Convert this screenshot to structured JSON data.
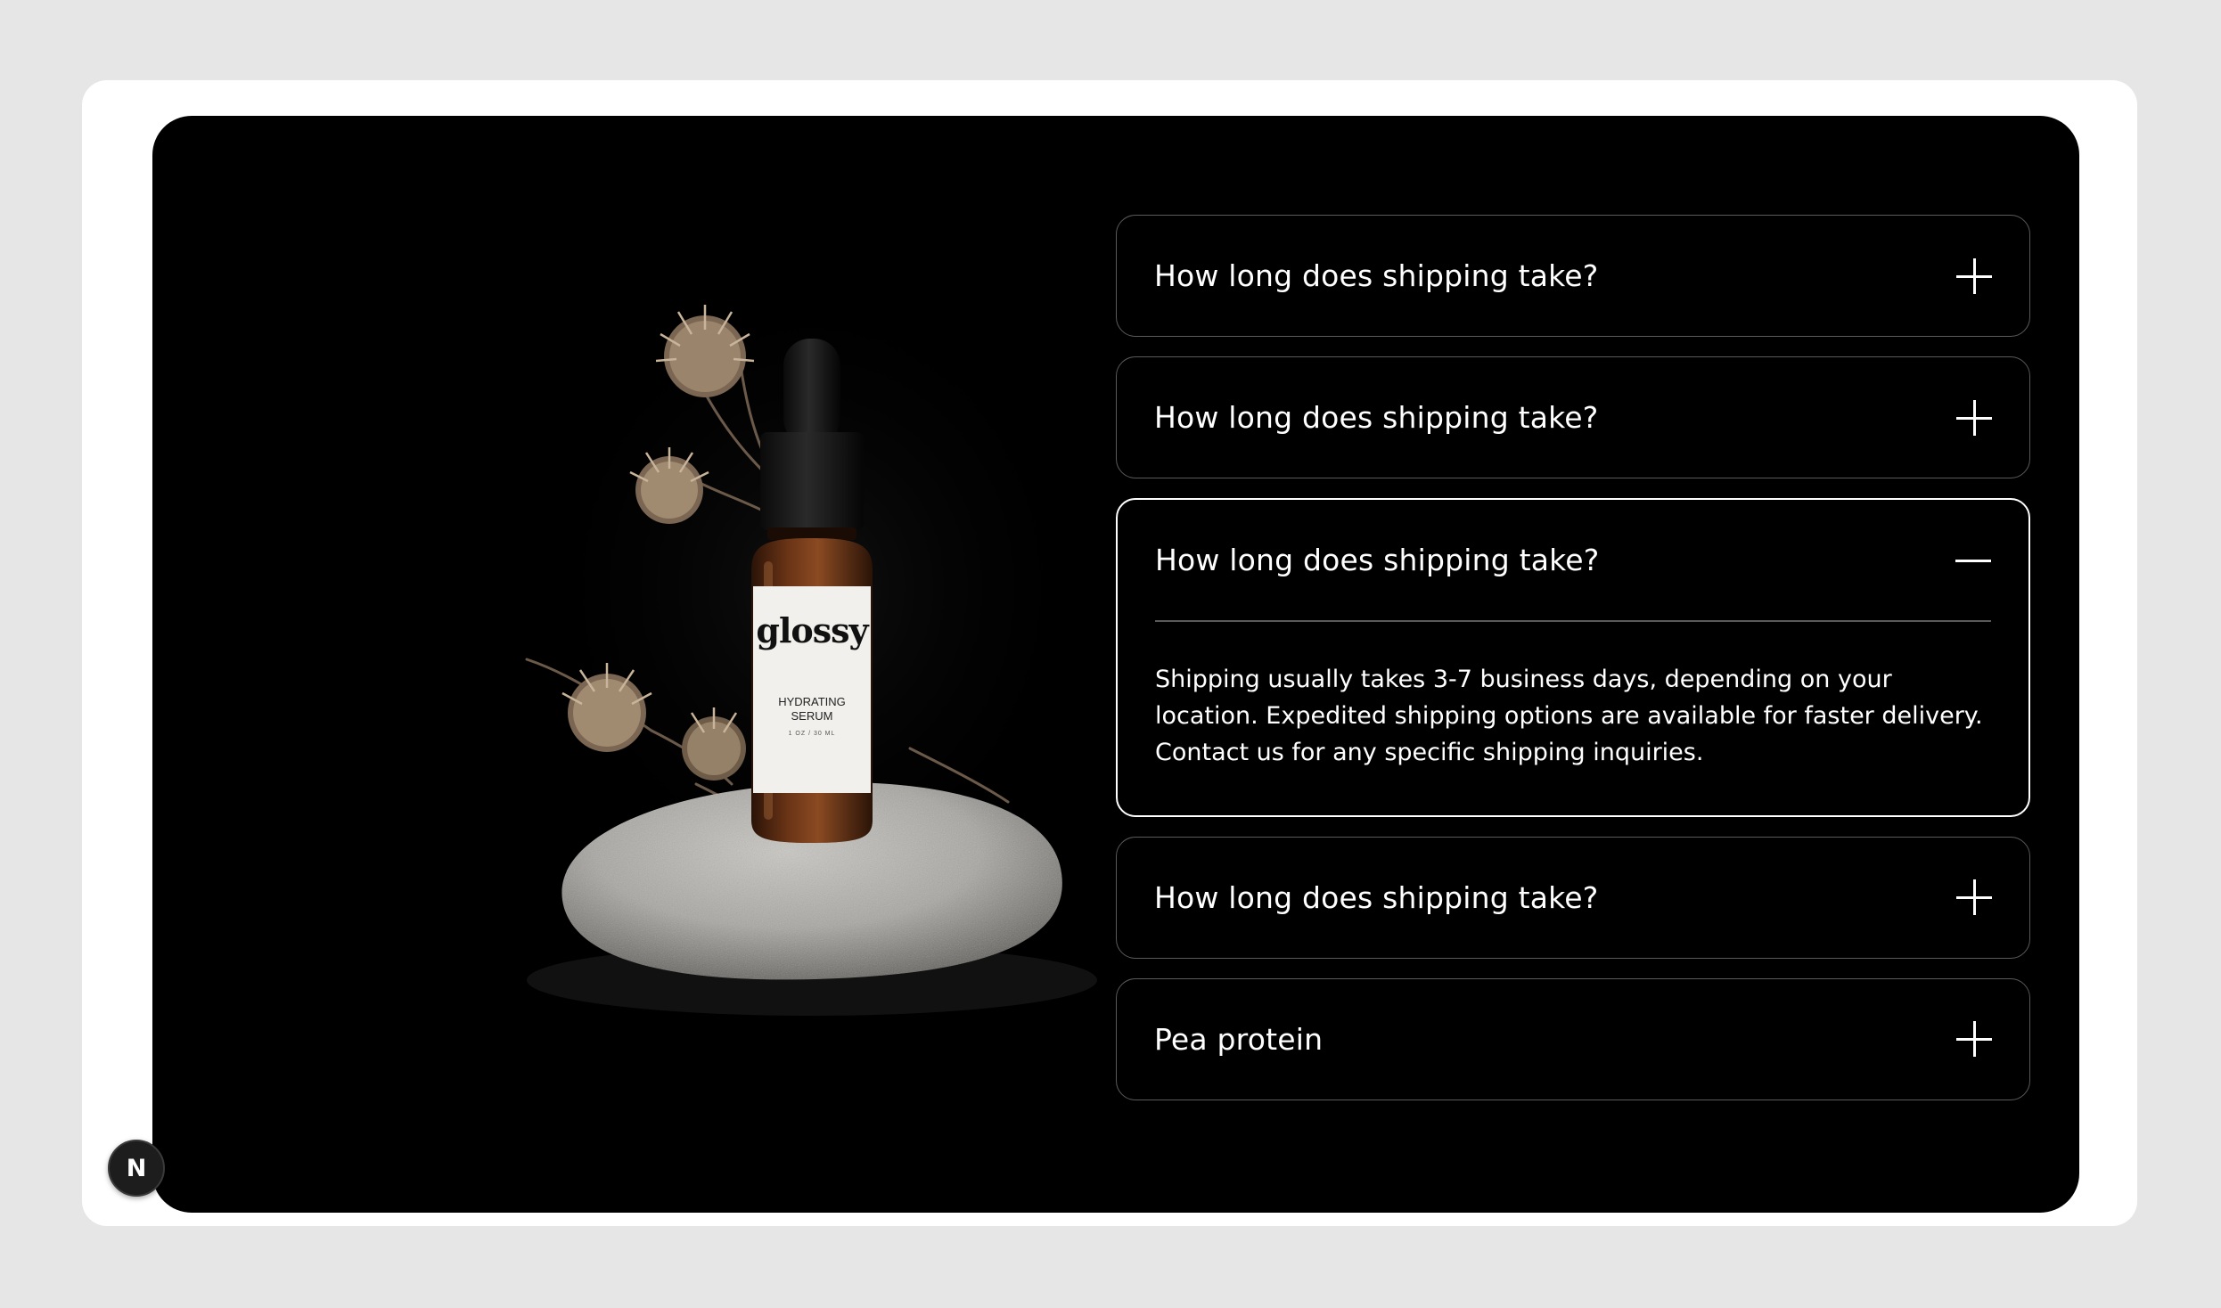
{
  "product": {
    "brand": "glossy",
    "name": "HYDRATING\nSERUM",
    "volume": "1 OZ / 30 ML"
  },
  "faq": {
    "items": [
      {
        "question": "How long does shipping take?",
        "open": false
      },
      {
        "question": "How long does shipping take?",
        "open": false
      },
      {
        "question": "How long does shipping take?",
        "open": true,
        "answer": "Shipping usually takes 3-7 business days, depending on your location. Expedited shipping options are available for faster delivery. Contact us for any specific shipping inquiries."
      },
      {
        "question": "How long does shipping take?",
        "open": false
      },
      {
        "question": "Pea protein",
        "open": false
      }
    ]
  },
  "badge": {
    "label": "N"
  },
  "colors": {
    "page_background": "#e6e6e6",
    "frame": "#ffffff",
    "panel": "#000000",
    "text": "#ffffff",
    "border": "#5a5a5a",
    "open_border": "#ffffff"
  },
  "icons": {
    "collapsed": "plus-icon",
    "expanded": "minus-icon"
  }
}
